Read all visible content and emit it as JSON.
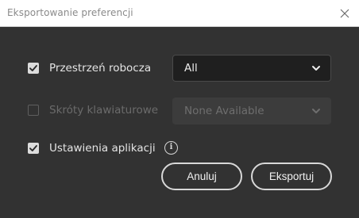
{
  "window": {
    "title": "Eksportowanie preferencji",
    "close_icon": "close-icon"
  },
  "options": [
    {
      "label": "Przestrzeń robocza",
      "checked": true,
      "enabled": true,
      "select_value": "All"
    },
    {
      "label": "Skróty klawiaturowe",
      "checked": false,
      "enabled": false,
      "select_value": "None Available"
    },
    {
      "label": "Ustawienia aplikacji",
      "checked": true,
      "enabled": true,
      "info_icon": "info-icon"
    }
  ],
  "buttons": {
    "cancel_label": "Anuluj",
    "export_label": "Eksportuj"
  },
  "colors": {
    "background": "#323232",
    "titlebar": "#ffffff",
    "checkbox_checked": "#dcdcdc",
    "text": "#e4e4e4",
    "disabled_text": "#6b6b6b"
  }
}
